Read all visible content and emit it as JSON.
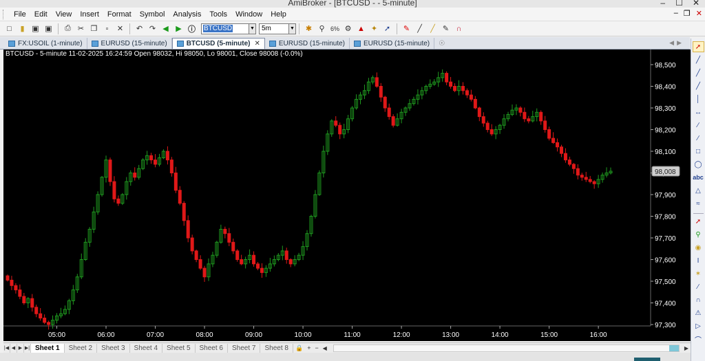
{
  "window": {
    "title": "AmiBroker - [BTCUSD - - 5-minute]",
    "controls": [
      "–",
      "☐",
      "✕"
    ]
  },
  "menu": {
    "items": [
      "File",
      "Edit",
      "View",
      "Insert",
      "Format",
      "Symbol",
      "Analysis",
      "Tools",
      "Window",
      "Help"
    ],
    "mdi_controls": [
      "–",
      "❐",
      "✕"
    ]
  },
  "toolbar": {
    "symbol": "BTCUSD",
    "interval": "5m"
  },
  "tabs": [
    {
      "label": "FX:USOIL (1-minute)",
      "active": false
    },
    {
      "label": "EURUSD (15-minute)",
      "active": false
    },
    {
      "label": "BTCUSD (5-minute)",
      "active": true
    },
    {
      "label": "EURUSD (15-minute)",
      "active": false
    },
    {
      "label": "EURUSD (15-minute)",
      "active": false
    }
  ],
  "chart_header": "BTCUSD - 5-minute 11-02-2025 16:24:59 Open 98032, Hi 98050, Lo 98001, Close 98008 (-0.0%)",
  "sheets": [
    "Sheet 1",
    "Sheet 2",
    "Sheet 3",
    "Sheet 4",
    "Sheet 5",
    "Sheet 6",
    "Sheet 7",
    "Sheet 8"
  ],
  "active_sheet": "Sheet 1",
  "colors": {
    "up": "#1f9a1f",
    "down": "#e01818",
    "background": "#000000",
    "axis_text": "#ffffff",
    "marker_bg": "#cfcfcf"
  },
  "chart_data": {
    "type": "candlestick",
    "symbol": "BTCUSD",
    "interval": "5-minute",
    "y_ticks": [
      98500,
      98400,
      98300,
      98200,
      98100,
      98000,
      97900,
      97800,
      97700,
      97600,
      97500,
      97400,
      97300
    ],
    "y_tick_labels": [
      "98,500",
      "98,400",
      "98,300",
      "98,200",
      "98,100",
      "98,000",
      "97,900",
      "97,800",
      "97,700",
      "97,600",
      "97,500",
      "97,400",
      "97,300"
    ],
    "x_tick_labels": [
      "05:00",
      "06:00",
      "07:00",
      "08:00",
      "09:00",
      "10:00",
      "11:00",
      "12:00",
      "13:00",
      "14:00",
      "15:00",
      "16:00"
    ],
    "x_tick_bars": [
      12,
      24,
      36,
      48,
      60,
      72,
      84,
      96,
      108,
      120,
      132,
      144
    ],
    "bars_count": 148,
    "last_price": 98008,
    "last_price_label": "98,008",
    "close_series": [
      97505,
      97480,
      97460,
      97430,
      97400,
      97420,
      97380,
      97350,
      97330,
      97310,
      97300,
      97320,
      97340,
      97350,
      97370,
      97410,
      97460,
      97520,
      97600,
      97680,
      97740,
      97820,
      97900,
      97980,
      98060,
      97960,
      97880,
      97860,
      97900,
      97960,
      98000,
      97980,
      98020,
      98060,
      98080,
      98060,
      98040,
      98070,
      98100,
      98060,
      98000,
      97920,
      97860,
      97780,
      97700,
      97640,
      97600,
      97560,
      97520,
      97580,
      97620,
      97680,
      97740,
      97720,
      97680,
      97640,
      97600,
      97580,
      97600,
      97620,
      97580,
      97560,
      97540,
      97560,
      97580,
      97600,
      97620,
      97640,
      97600,
      97580,
      97600,
      97620,
      97660,
      97720,
      97800,
      97900,
      98000,
      98100,
      98180,
      98240,
      98220,
      98180,
      98200,
      98250,
      98300,
      98340,
      98360,
      98380,
      98420,
      98440,
      98400,
      98350,
      98300,
      98260,
      98220,
      98250,
      98280,
      98300,
      98320,
      98340,
      98360,
      98380,
      98400,
      98410,
      98420,
      98440,
      98460,
      98420,
      98400,
      98380,
      98400,
      98380,
      98360,
      98340,
      98300,
      98260,
      98230,
      98200,
      98180,
      98200,
      98220,
      98250,
      98270,
      98290,
      98300,
      98280,
      98250,
      98240,
      98260,
      98280,
      98240,
      98200,
      98160,
      98140,
      98120,
      98090,
      98060,
      98040,
      98020,
      97990,
      97980,
      97970,
      97960,
      97950,
      97970,
      97990,
      98000,
      98008
    ]
  }
}
